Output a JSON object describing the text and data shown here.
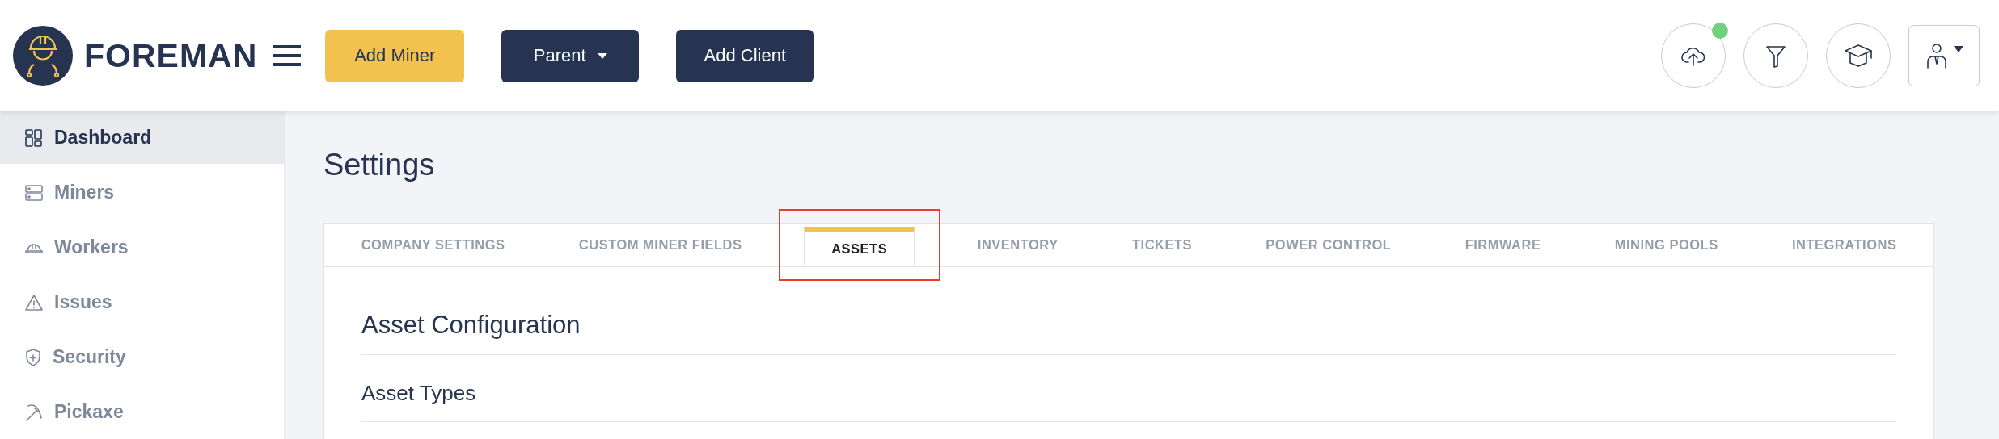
{
  "logo": {
    "text": "FOREMAN"
  },
  "header_buttons": [
    {
      "label": "Add Miner",
      "kind": "primary"
    },
    {
      "label": "Parent",
      "kind": "dropdown"
    },
    {
      "label": "Add Client",
      "kind": "dark"
    }
  ],
  "header_icons": [
    {
      "kind": "upload",
      "notification": true
    },
    {
      "kind": "filter",
      "notification": false
    },
    {
      "kind": "academy",
      "notification": false
    },
    {
      "kind": "user",
      "notification": false
    }
  ],
  "sidebar": {
    "items": [
      {
        "label": "Dashboard",
        "kind": "dashboard",
        "selected": true
      },
      {
        "label": "Miners",
        "kind": "miners",
        "selected": false
      },
      {
        "label": "Workers",
        "kind": "workers",
        "selected": false
      },
      {
        "label": "Issues",
        "kind": "issues",
        "selected": false
      },
      {
        "label": "Security",
        "kind": "security",
        "selected": false
      },
      {
        "label": "Pickaxe",
        "kind": "pickaxe",
        "selected": false
      }
    ]
  },
  "page": {
    "title": "Settings"
  },
  "tabs": [
    {
      "label": "COMPANY SETTINGS",
      "selected": false,
      "highlighted": false
    },
    {
      "label": "CUSTOM MINER FIELDS",
      "selected": false,
      "highlighted": false
    },
    {
      "label": "ASSETS",
      "selected": true,
      "highlighted": true
    },
    {
      "label": "INVENTORY",
      "selected": false,
      "highlighted": false
    },
    {
      "label": "TICKETS",
      "selected": false,
      "highlighted": false
    },
    {
      "label": "POWER CONTROL",
      "selected": false,
      "highlighted": false
    },
    {
      "label": "FIRMWARE",
      "selected": false,
      "highlighted": false
    },
    {
      "label": "MINING POOLS",
      "selected": false,
      "highlighted": false
    },
    {
      "label": "INTEGRATIONS",
      "selected": false,
      "highlighted": false
    }
  ],
  "section": {
    "title": "Asset Configuration",
    "subsection": "Asset Types"
  }
}
